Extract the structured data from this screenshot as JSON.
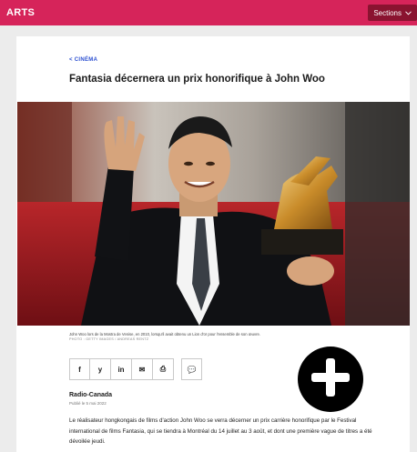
{
  "header": {
    "section_title": "ARTS",
    "sections_label": "Sections",
    "sections_icon": "chevron-down-icon"
  },
  "article": {
    "breadcrumb": "< CINÉMA",
    "title": "Fantasia décernera un prix honorifique à John Woo",
    "caption": "John Woo lors de la Mostra de Venise, en 2010, lorsqu'il avait obtenu un Lion d'or pour l'ensemble de son œuvre.",
    "photo_credit": "PHOTO : GETTY IMAGES / ANDREAS RENTZ",
    "author": "Radio-Canada",
    "published": "Publié le 5 mai 2022",
    "body": "Le réalisateur hongkongais de films d'action John Woo se verra décerner un prix carrière honorifique par le Festival international de films Fantasia, qui se tiendra à Montréal du 14 juillet au 3 août, et dont une première vague de titres a été dévoilée jeudi."
  },
  "share": {
    "buttons": [
      {
        "label": "f",
        "icon": "facebook-icon"
      },
      {
        "label": "y",
        "icon": "twitter-icon"
      },
      {
        "label": "in",
        "icon": "linkedin-icon"
      },
      {
        "label": "✉",
        "icon": "email-icon"
      },
      {
        "label": "⎙",
        "icon": "print-icon"
      },
      {
        "label": "💬",
        "icon": "comment-icon"
      }
    ]
  },
  "overlay": {
    "icon": "plus-icon"
  },
  "colors": {
    "brand": "#d6245a",
    "sections_button": "#8a1330",
    "link": "#2b4fd1"
  }
}
